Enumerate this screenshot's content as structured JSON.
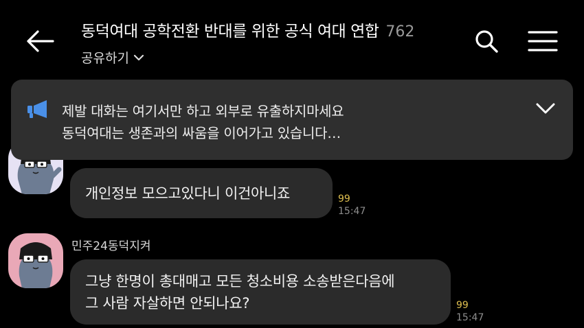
{
  "header": {
    "back_icon": "arrow-left-icon",
    "title": "동덕여대 공학전환 반대를 위한 공식 여대 연합",
    "member_count": "762",
    "share_label": "공유하기",
    "share_icon": "chevron-down-icon",
    "search_icon": "search-icon",
    "menu_icon": "hamburger-menu-icon"
  },
  "notice": {
    "icon": "megaphone-icon",
    "icon_color": "#4a90e8",
    "line1": "제발 대화는 여기서만 하고 외부로 유출하지마세요",
    "line2": "동덕여대는 생존과의 싸움을 이어가고 있습니다…",
    "toggle_icon": "chevron-down-icon"
  },
  "messages": [
    {
      "avatar_color": "#e6e2f4",
      "text": "개인정보 모으고있다니 이건아니죠",
      "unread": "99",
      "time": "15:47"
    },
    {
      "sender": "민주24동덕지켜",
      "avatar_color": "#e9a8b7",
      "text_line1": "그냥 한명이 총대매고 모든 청소비용 소송받은다음에",
      "text_line2": "그 사람 자살하면 안되나요?",
      "unread": "99",
      "time": "15:47"
    }
  ],
  "colors": {
    "background": "#000000",
    "bubble": "#2b2b2b",
    "notice_bg": "#2f2f2f",
    "unread": "#e0c050",
    "time": "#8e8e8e"
  }
}
